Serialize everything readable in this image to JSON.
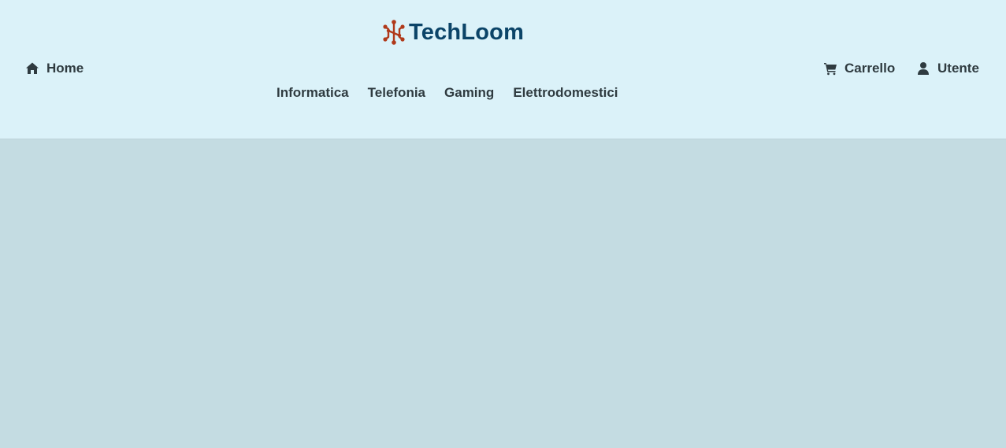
{
  "brand": {
    "name": "TechLoom",
    "logo_icon": "network-nodes-icon",
    "logo_color": "#b0391a",
    "text_color": "#0b4468"
  },
  "header": {
    "background": "#dbf2f9",
    "home": {
      "label": "Home",
      "icon": "home-icon"
    },
    "cart": {
      "label": "Carrello",
      "icon": "cart-icon"
    },
    "user": {
      "label": "Utente",
      "icon": "user-icon"
    },
    "categories": [
      {
        "label": "Informatica"
      },
      {
        "label": "Telefonia"
      },
      {
        "label": "Gaming"
      },
      {
        "label": "Elettrodomestici"
      }
    ]
  },
  "main": {
    "background": "#c4dce2"
  }
}
